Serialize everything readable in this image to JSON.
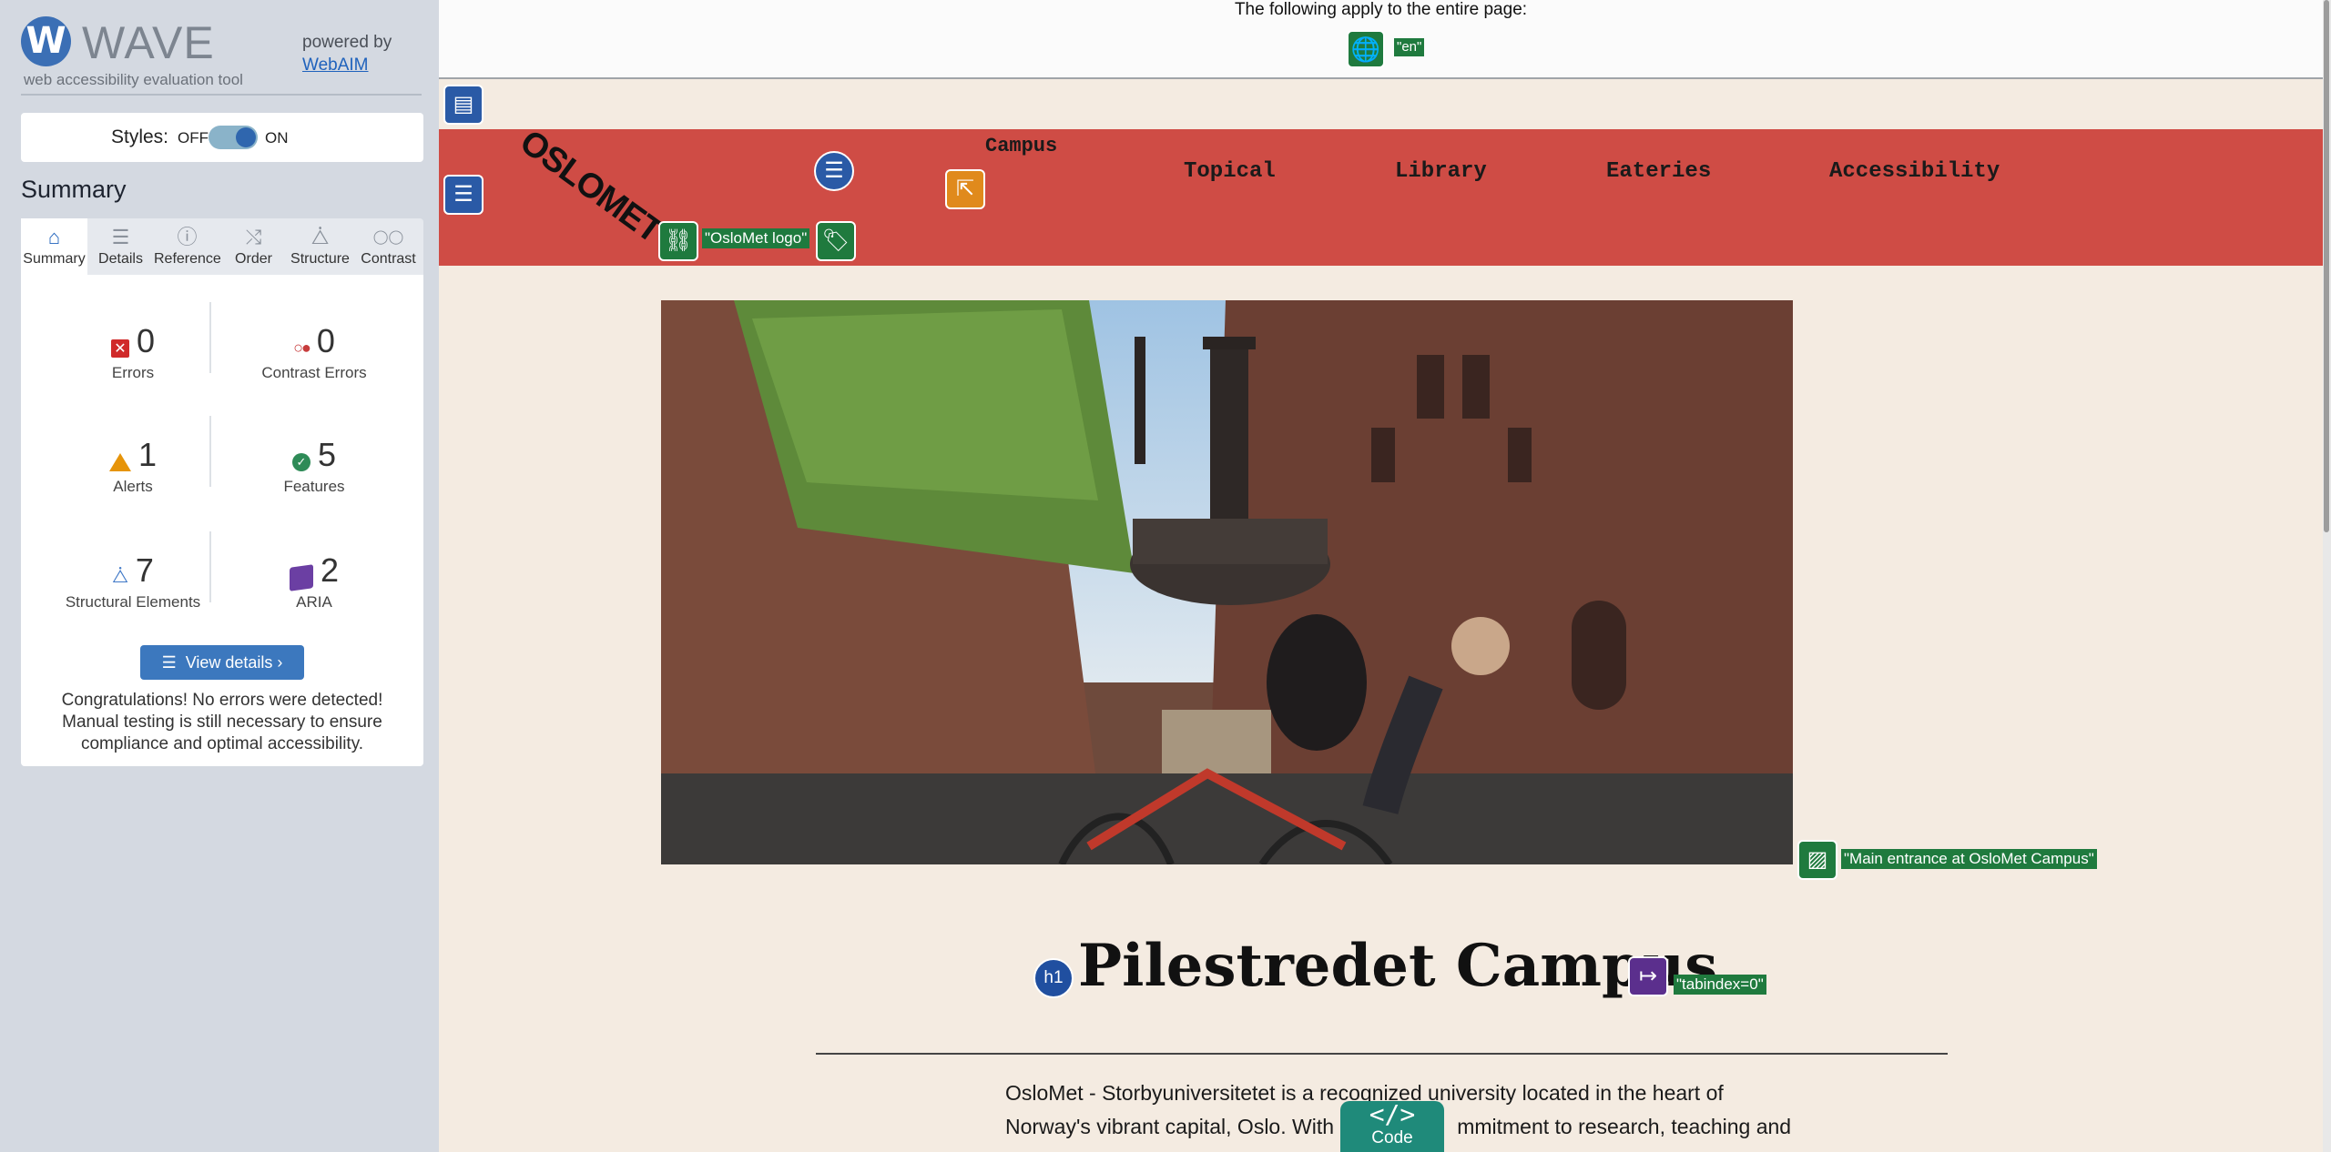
{
  "sidebar": {
    "logo_letter": "W",
    "logo_word": "WAVE",
    "tagline": "web accessibility evaluation tool",
    "powered_by": "powered by",
    "webaim_link": "WebAIM",
    "styles_label": "Styles:",
    "styles_off": "OFF",
    "styles_on": "ON",
    "summary_title": "Summary",
    "tabs": [
      {
        "label": "Summary",
        "icon": "home-icon",
        "glyph": "⌂"
      },
      {
        "label": "Details",
        "icon": "list-icon",
        "glyph": "☰"
      },
      {
        "label": "Reference",
        "icon": "info-icon",
        "glyph": "ⓘ"
      },
      {
        "label": "Order",
        "icon": "order-icon",
        "glyph": "⤭"
      },
      {
        "label": "Structure",
        "icon": "structure-icon",
        "glyph": "⧊"
      },
      {
        "label": "Contrast",
        "icon": "contrast-icon",
        "glyph": "◯◯"
      }
    ],
    "stats": {
      "errors": {
        "count": "0",
        "label": "Errors"
      },
      "contrast_errors": {
        "count": "0",
        "label": "Contrast Errors"
      },
      "alerts": {
        "count": "1",
        "label": "Alerts"
      },
      "features": {
        "count": "5",
        "label": "Features"
      },
      "structural": {
        "count": "7",
        "label": "Structural Elements"
      },
      "aria": {
        "count": "2",
        "label": "ARIA"
      }
    },
    "view_details": "View details ›",
    "congrats": "Congratulations! No errors were detected! Manual testing is still necessary to ensure compliance and optimal accessibility."
  },
  "page": {
    "top_text": "The following apply to the entire page:",
    "lang_tag": "\"en\"",
    "nav": {
      "logo_text": "OSLOMET",
      "logo_alt": "\"OsloMet logo\"",
      "links": [
        "Campus",
        "Topical",
        "Library",
        "Eateries",
        "Accessibility"
      ]
    },
    "image_alt": "\"Main entrance at OsloMet Campus\"",
    "heading": "Pilestredet Campus",
    "h1_badge": "h1",
    "tabindex_tag": "\"tabindex=0\"",
    "paragraph_line1": "OsloMet - Storbyuniversitetet is a recognized university located in the heart of",
    "paragraph_line2a": "Norway's vibrant capital, Oslo. With a",
    "paragraph_line2b": "mmitment to research, teaching and",
    "code_button": "Code",
    "code_glyph": "</>"
  },
  "colors": {
    "nav_red": "#cf4c45",
    "page_bg": "#f4ebe1",
    "sidebar_bg": "#d4d9e1",
    "wave_green": "#1f7a3e",
    "wave_blue": "#2a5aa6"
  }
}
